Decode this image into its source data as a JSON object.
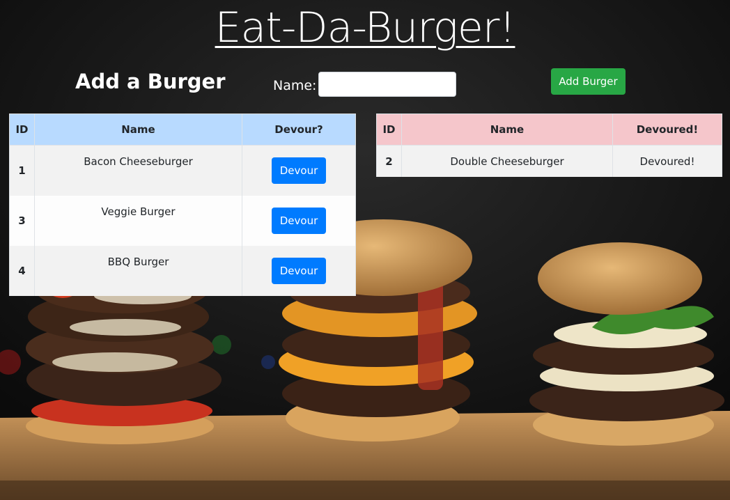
{
  "header": {
    "title": "Eat-Da-Burger!"
  },
  "form": {
    "heading": "Add a Burger",
    "name_label": "Name:",
    "name_value": "",
    "add_button": "Add Burger"
  },
  "to_devour": {
    "columns": [
      "ID",
      "Name",
      "Devour?"
    ],
    "rows": [
      {
        "id": "1",
        "name": "Bacon Cheeseburger",
        "action": "Devour"
      },
      {
        "id": "3",
        "name": "Veggie Burger",
        "action": "Devour"
      },
      {
        "id": "4",
        "name": "BBQ Burger",
        "action": "Devour"
      }
    ]
  },
  "devoured": {
    "columns": [
      "ID",
      "Name",
      "Devoured!"
    ],
    "rows": [
      {
        "id": "2",
        "name": "Double Cheeseburger",
        "status": "Devoured!"
      }
    ]
  },
  "colors": {
    "add_button": "#28a745",
    "devour_button": "#007bff",
    "devour_header": "#b8daff",
    "devoured_header": "#f5c6cb"
  }
}
